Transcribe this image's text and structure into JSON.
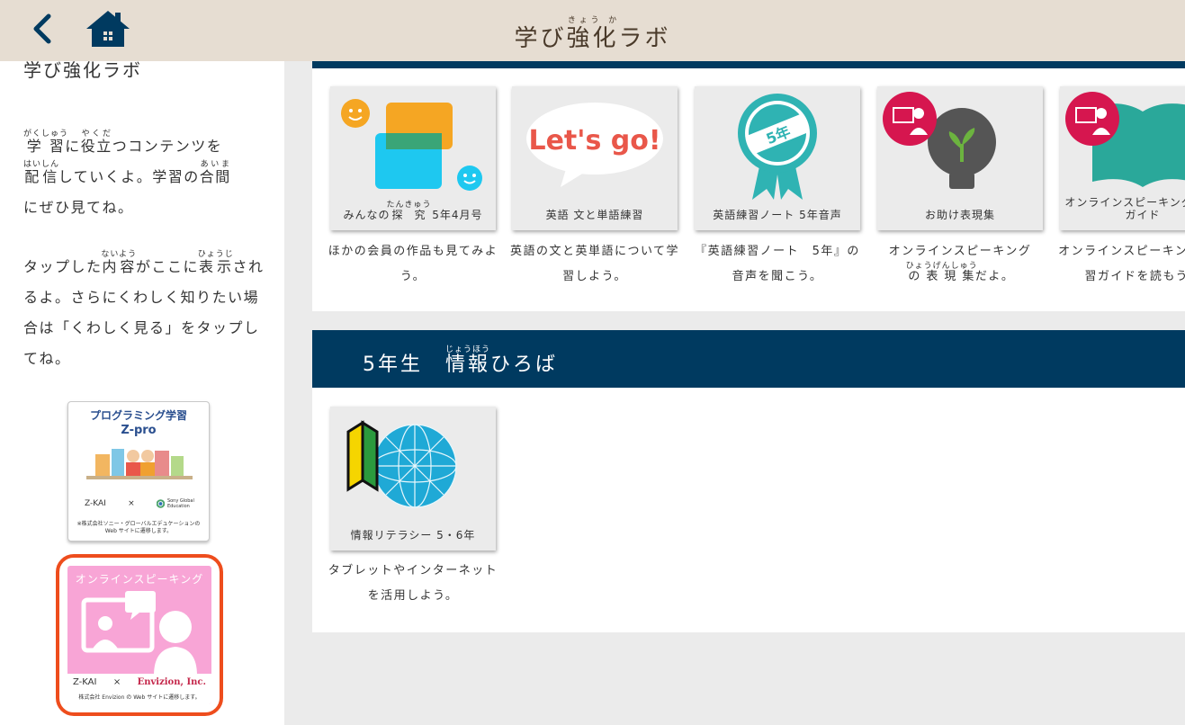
{
  "header": {
    "title_base_1": "学び",
    "title_base_2": "強化",
    "title_ruby_2": "きょう か",
    "title_base_3": "ラボ"
  },
  "sidebar": {
    "title": "学び強化ラボ",
    "p1": {
      "w1": "学習",
      "w1_ruby": "がくしゅう",
      "t1": "に",
      "w2": "役立",
      "w2_ruby": "やくだ",
      "t2": "つコンテンツを",
      "w3": "配信",
      "w3_ruby": "はいしん",
      "t3": "していくよ。学習の",
      "w4": "合間",
      "w4_ruby": "あいま",
      "t4": "にぜひ見てね。"
    },
    "p2": {
      "t1": "タップした",
      "w1": "内容",
      "w1_ruby": "ないよう",
      "t2": "がここに",
      "w2": "表示",
      "w2_ruby": "ひょうじ",
      "t3": "されるよ。さらにくわしく知りたい場合は「くわしく見る」をタップしてね。"
    },
    "banner_prog": {
      "title": "プログラミング学習",
      "subtitle": "Z-pro",
      "logo_left": "Z-KAI",
      "times": "×",
      "logo_right": "Sony Global Education",
      "note": "※株式会社ソニー・グローバルエデュケーションの Web サイトに遷移します。"
    },
    "banner_speak": {
      "title": "オンラインスピーキング",
      "logo_left": "Z-KAI",
      "times": "×",
      "logo_right": "Envizion, Inc.",
      "note": "株式会社 Envizion の Web サイトに遷移します。"
    }
  },
  "cards_top": [
    {
      "label_pre": "みんなの",
      "label_w": "探究",
      "label_ruby": "たんきゅう",
      "label_post": " 5年4月号",
      "desc": "ほかの会員の作品も見てみよう。",
      "icon": "chat-bubbles-icon"
    },
    {
      "label": "英語 文と単語練習",
      "art_text": "Let's go!",
      "desc": "英語の文と英単語について学習しよう。",
      "icon": "lets-go-bubble-icon"
    },
    {
      "label": "英語練習ノート 5年音声",
      "art_text": "5年",
      "desc": "『英語練習ノート　5年』の音声を聞こう。",
      "icon": "ribbon-badge-icon"
    },
    {
      "label": "お助け表現集",
      "desc_pre": "オンラインスピーキング",
      "desc_w": "の表現集",
      "desc_ruby": "ひょうげんしゅう",
      "desc_post": "だよ。",
      "icon": "lightbulb-icon"
    },
    {
      "label": "オンラインスピーキング 学習ガイド",
      "desc": "オンラインスピーキングの学習ガイドを読もう。",
      "icon": "open-book-icon"
    }
  ],
  "section2": {
    "title_pre": "5年生　",
    "title_w": "情報",
    "title_ruby": "じょうほう",
    "title_post": "ひろば",
    "cards": [
      {
        "label": "情報リテラシー 5・6年",
        "desc": "タブレットやインターネットを活用しよう。",
        "icon": "globe-beginner-icon"
      }
    ]
  },
  "colors": {
    "header_bg": "#e6ddd2",
    "navy": "#003a60",
    "highlight": "#ee4d1d",
    "speak_pink": "#f8a5d6"
  }
}
